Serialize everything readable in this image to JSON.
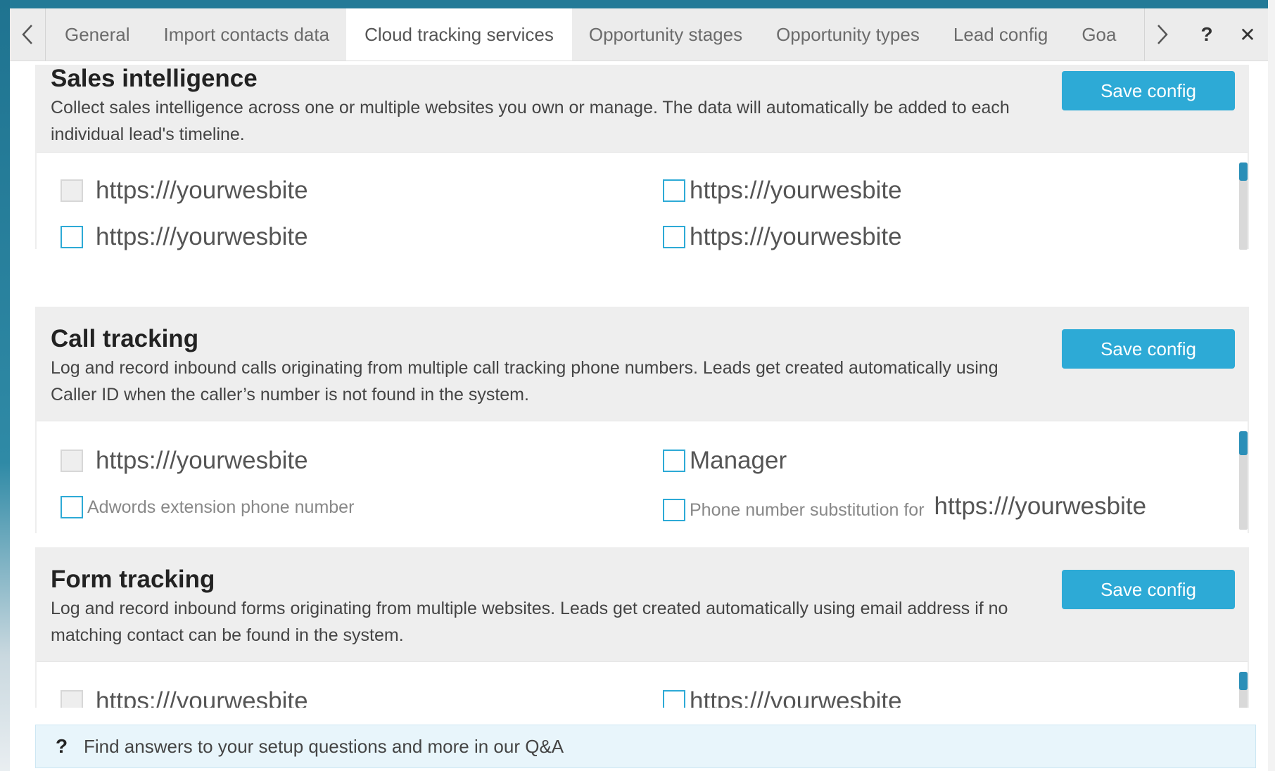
{
  "tabs": {
    "items": [
      {
        "label": "General",
        "active": false
      },
      {
        "label": "Import contacts data",
        "active": false
      },
      {
        "label": "Cloud tracking services",
        "active": true
      },
      {
        "label": "Opportunity stages",
        "active": false
      },
      {
        "label": "Opportunity types",
        "active": false
      },
      {
        "label": "Lead config",
        "active": false
      },
      {
        "label": "Goa",
        "active": false
      }
    ],
    "help_label": "?",
    "close_label": "✕"
  },
  "sections": [
    {
      "title": "Sales intelligence",
      "description": "Collect sales intelligence across one or multiple websites you own or manage. The data will automatically be added to each individual lead's timeline.",
      "save_label": "Save config",
      "options": [
        {
          "label": "https:///yourwesbite",
          "checked": false
        },
        {
          "label": "https:///yourwesbite",
          "checked": true
        },
        {
          "label": "https:///yourwesbite",
          "checked": true
        },
        {
          "label": "https:///yourwesbite",
          "checked": true
        }
      ]
    },
    {
      "title": "Call tracking",
      "description": "Log and record inbound calls originating from multiple call tracking phone numbers. Leads get created automatically using Caller ID when the caller’s number is not found in the system.",
      "save_label": "Save config",
      "options": [
        {
          "label": "https:///yourwesbite",
          "checked": false
        },
        {
          "label": "Manager",
          "checked": true
        },
        {
          "label": "Adwords extension phone number",
          "checked": true
        },
        {
          "label": "Phone number substitution for",
          "suffix": "https:///yourwesbite",
          "checked": true
        }
      ]
    },
    {
      "title": "Form tracking",
      "description": "Log and record inbound forms originating from multiple websites. Leads get created automatically using email address if no matching contact can be found in the system.",
      "save_label": "Save config",
      "options": [
        {
          "label": "https:///yourwesbite",
          "checked": false
        },
        {
          "label": "https:///yourwesbite",
          "checked": true
        }
      ]
    }
  ],
  "footer": {
    "icon": "?",
    "text": "Find answers to your setup questions and more in our Q&A"
  },
  "colors": {
    "accent": "#2daad6",
    "scroll_thumb": "#2b8fb8",
    "footer_bg": "#e8f5fb"
  }
}
